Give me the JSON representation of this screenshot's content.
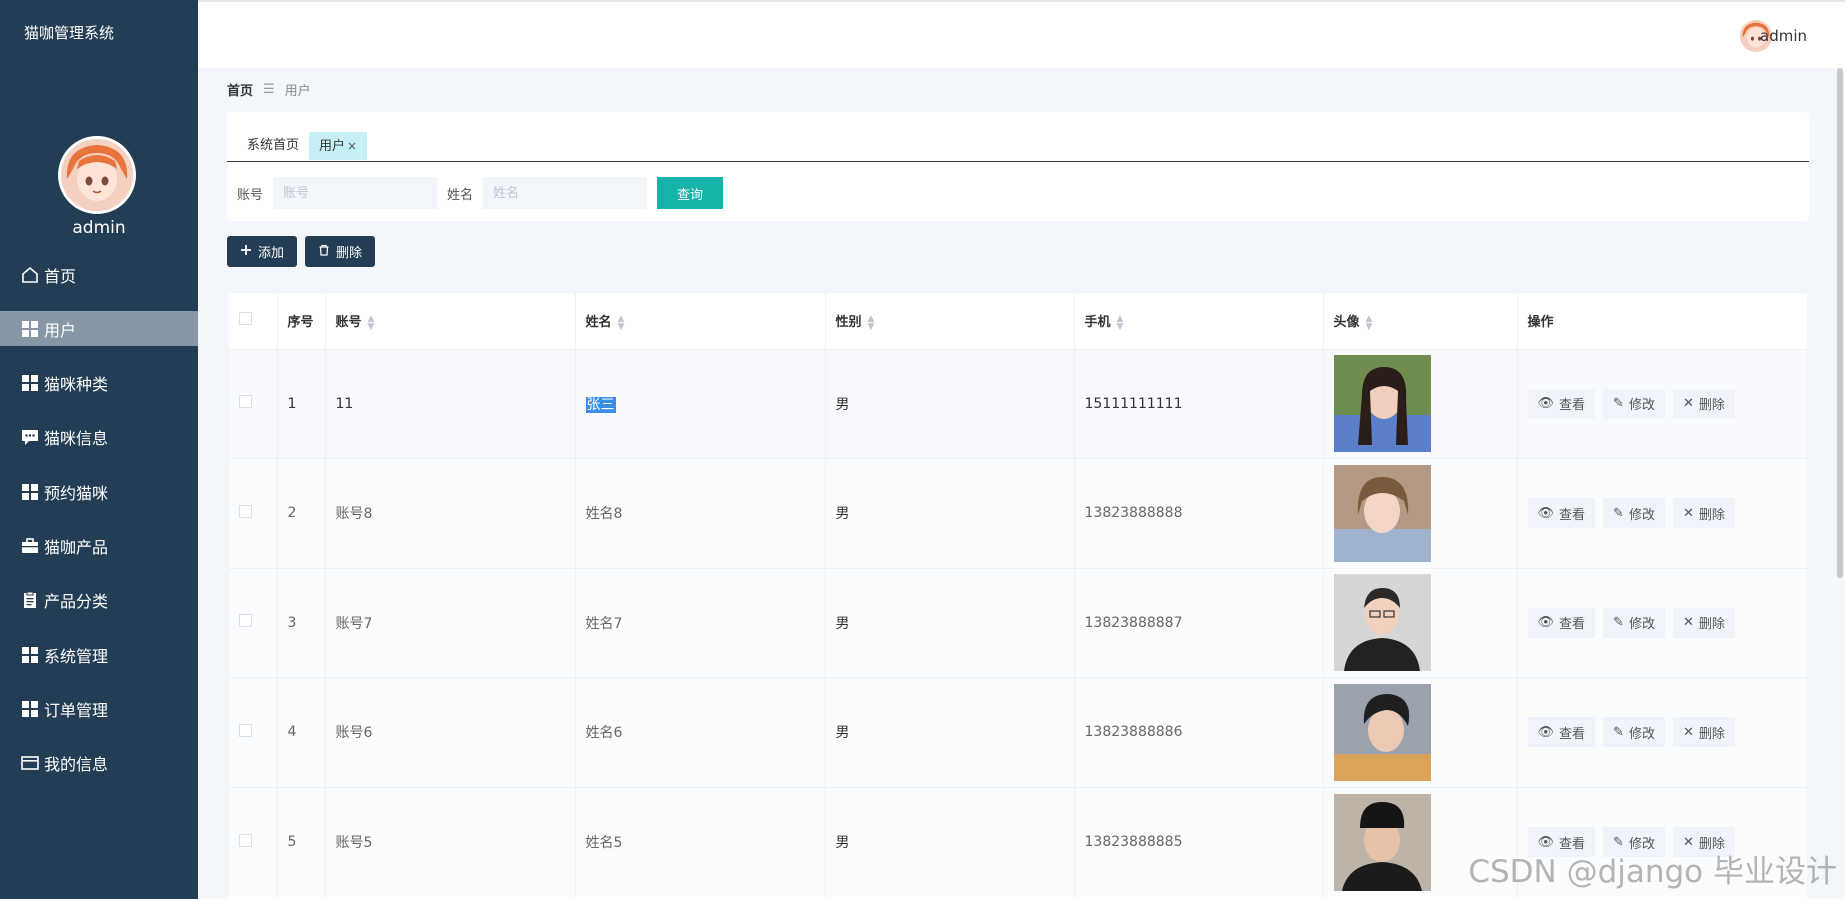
{
  "app": {
    "title": "猫咖管理系统"
  },
  "sidebar": {
    "username": "admin",
    "items": [
      {
        "label": "首页",
        "icon": "home-icon"
      },
      {
        "label": "用户",
        "icon": "grid-icon",
        "active": true
      },
      {
        "label": "猫咪种类",
        "icon": "grid-icon"
      },
      {
        "label": "猫咪信息",
        "icon": "chat-icon"
      },
      {
        "label": "预约猫咪",
        "icon": "grid-icon"
      },
      {
        "label": "猫咖产品",
        "icon": "briefcase-icon"
      },
      {
        "label": "产品分类",
        "icon": "clipboard-icon"
      },
      {
        "label": "系统管理",
        "icon": "grid-icon"
      },
      {
        "label": "订单管理",
        "icon": "grid-icon"
      },
      {
        "label": "我的信息",
        "icon": "card-icon"
      }
    ]
  },
  "topbar": {
    "username": "admin"
  },
  "breadcrumb": {
    "home": "首页",
    "separator": "☰",
    "current": "用户"
  },
  "tabs": [
    {
      "label": "系统首页"
    },
    {
      "label": "用户",
      "close": "×"
    }
  ],
  "search": {
    "account_label": "账号",
    "account_placeholder": "账号",
    "name_label": "姓名",
    "name_placeholder": "姓名",
    "query_label": "查询"
  },
  "actions": {
    "add_label": "添加",
    "delete_label": "删除"
  },
  "table": {
    "headers": {
      "index": "序号",
      "account": "账号",
      "name": "姓名",
      "gender": "性别",
      "phone": "手机",
      "avatar": "头像",
      "ops": "操作"
    },
    "op_labels": {
      "view": "查看",
      "edit": "修改",
      "delete": "删除"
    },
    "rows": [
      {
        "index": "1",
        "account": "11",
        "name": "张三",
        "gender": "男",
        "phone": "15111111111"
      },
      {
        "index": "2",
        "account": "账号8",
        "name": "姓名8",
        "gender": "男",
        "phone": "13823888888"
      },
      {
        "index": "3",
        "account": "账号7",
        "name": "姓名7",
        "gender": "男",
        "phone": "13823888887"
      },
      {
        "index": "4",
        "account": "账号6",
        "name": "姓名6",
        "gender": "男",
        "phone": "13823888886"
      },
      {
        "index": "5",
        "account": "账号5",
        "name": "姓名5",
        "gender": "男",
        "phone": "13823888885"
      }
    ]
  },
  "watermark": "CSDN @django 毕业设计",
  "colors": {
    "sidebar": "#233e54",
    "accent": "#16b3ab",
    "active_tab": "#c6f0f6",
    "active_nav": "#8797a6"
  }
}
